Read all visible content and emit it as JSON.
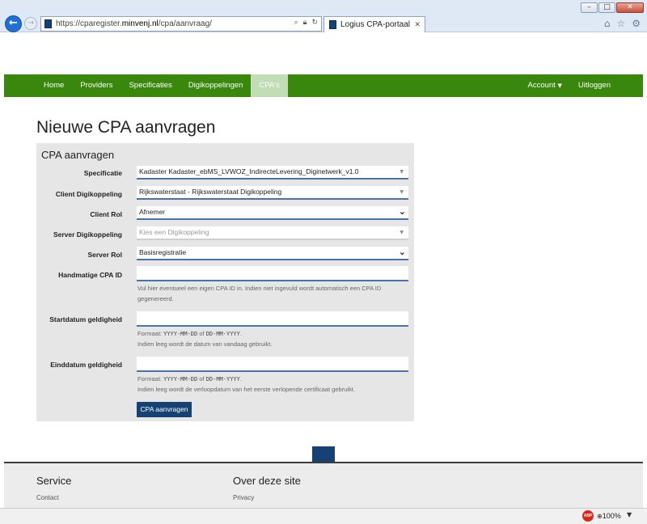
{
  "browser": {
    "url_prefix": "https://cparegister.",
    "url_domain": "minvenj.nl",
    "url_path": "/cpa/aanvraag/",
    "tab_title": "Logius CPA-portaal",
    "zoom": "100%",
    "abp_label": "ABP"
  },
  "nav": {
    "items": [
      "Home",
      "Providers",
      "Specificaties",
      "Digikoppelingen",
      "CPA's"
    ],
    "active_index": 4,
    "account": "Account",
    "logout": "Uitloggen"
  },
  "page": {
    "title": "Nieuwe CPA aanvragen",
    "panel_title": "CPA aanvragen"
  },
  "form": {
    "specificatie_label": "Specificatie",
    "specificatie_value": "Kadaster Kadaster_ebMS_LVWOZ_IndirecteLevering_Diginetwerk_v1.0",
    "client_dk_label": "Client Digikoppeling",
    "client_dk_value": "Rijkswaterstaat - Rijkswaterstaat Digikoppeling",
    "client_rol_label": "Client Rol",
    "client_rol_value": "Afnemer",
    "server_dk_label": "Server Digikoppeling",
    "server_dk_placeholder": "Kies een Digikoppeling",
    "server_rol_label": "Server Rol",
    "server_rol_value": "Basisregistratie",
    "cpa_id_label": "Handmatige CPA ID",
    "cpa_id_help": "Vul hier eventueel een eigen CPA ID in. Indien niet ingevuld wordt automatisch een CPA ID gegenereerd.",
    "start_label": "Startdatum geldigheid",
    "eind_label": "Einddatum geldigheid",
    "format_prefix": "Formaat: ",
    "format_a": "YYYY-MM-DD",
    "format_of": " of ",
    "format_b": "DD-MM-YYYY",
    "format_suffix": ".",
    "start_help": "Indien leeg wordt de datum van vandaag gebruikt.",
    "eind_help": "Indien leeg wordt de verloopdatum van het eerste verlopende certificaat gebruikt.",
    "submit": "CPA aanvragen"
  },
  "footer": {
    "col1_title": "Service",
    "col1_link": "Contact",
    "col2_title": "Over deze site",
    "col2_link": "Privacy"
  },
  "colors": {
    "nav_green": "#39870c",
    "brand_blue": "#154273",
    "active_tab": "#c2dcb5"
  }
}
